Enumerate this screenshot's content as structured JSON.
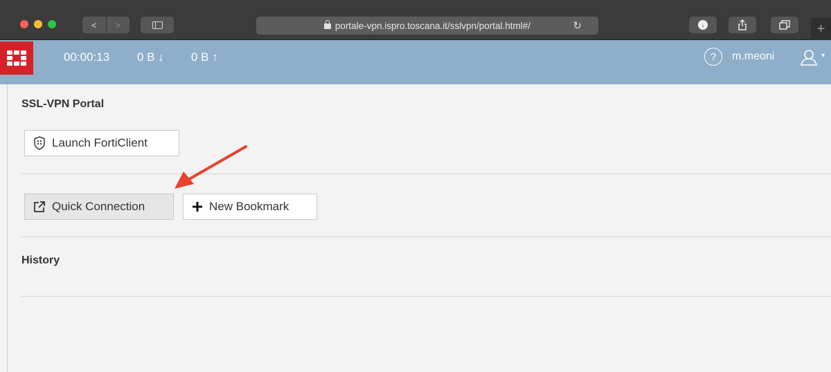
{
  "browser": {
    "url": "portale-vpn.ispro.toscana.it/sslvpn/portal.html#/",
    "back_glyph": "<",
    "forward_glyph": ">",
    "reload_glyph": "↻",
    "new_tab_glyph": "+"
  },
  "header": {
    "session_time": "00:00:13",
    "download": "0 B ↓",
    "upload": "0 B ↑",
    "help_glyph": "?",
    "username": "m.meoni",
    "caret_glyph": "▾"
  },
  "portal": {
    "title": "SSL-VPN Portal",
    "launch_label": "Launch FortiClient",
    "quick_label": "Quick Connection",
    "bookmark_label": "New Bookmark",
    "history_title": "History"
  },
  "colors": {
    "header_bg": "#8eaec9",
    "logo_red": "#d6212a",
    "annotation_arrow": "#e8412c",
    "chrome_bg": "#3b3b3b"
  }
}
